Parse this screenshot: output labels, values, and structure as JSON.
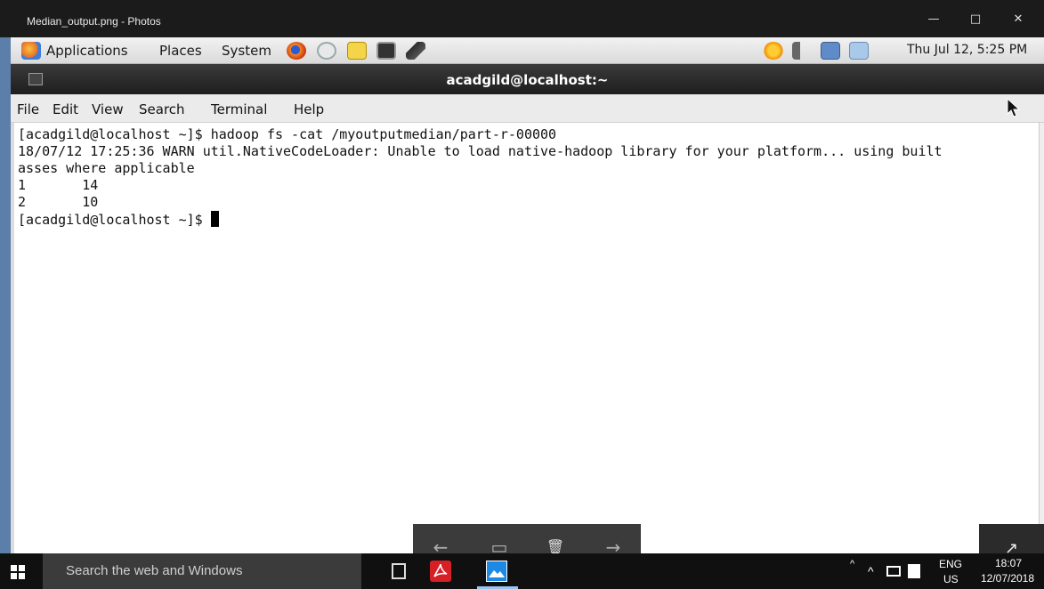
{
  "photos_window": {
    "title": "Median_output.png - Photos",
    "minimize": "—",
    "maximize": "□",
    "close": "✕"
  },
  "gnome_panel": {
    "applications": "Applications",
    "places": "Places",
    "system": "System",
    "datetime": "Thu Jul 12,  5:25 PM"
  },
  "terminal": {
    "title": "acadgild@localhost:~",
    "menu": [
      "File",
      "Edit",
      "View",
      "Search",
      "Terminal",
      "Help"
    ],
    "lines": [
      "[acadgild@localhost ~]$ hadoop fs -cat /myoutputmedian/part-r-00000",
      "18/07/12 17:25:36 WARN util.NativeCodeLoader: Unable to load native-hadoop library for your platform... using built",
      "asses where applicable",
      "1       14",
      "2       10"
    ],
    "prompt": "[acadgild@localhost ~]$ "
  },
  "photos_controls": {
    "prev": "←",
    "slideshow": "▭",
    "delete": "🗑",
    "next": "→",
    "expand": "↗"
  },
  "taskbar": {
    "search_placeholder": "Search the web and Windows",
    "language_top": "ENG",
    "language_bottom": "US",
    "time": "18:07",
    "date": "12/07/2018"
  }
}
